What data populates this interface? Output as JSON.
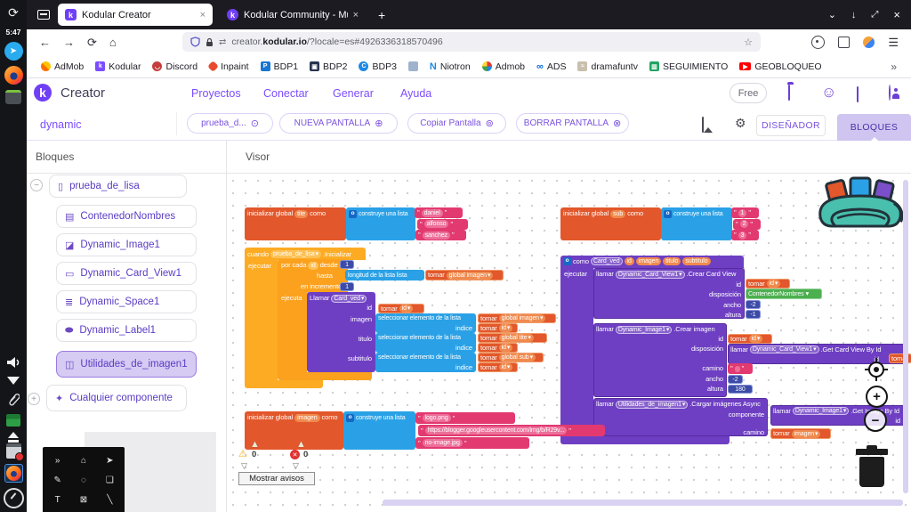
{
  "taskbar": {
    "time": "5:47"
  },
  "browser": {
    "tab1": "Kodular Creator",
    "tab2": "Kodular Community - Mu",
    "url_prefix": "creator.",
    "url_domain": "kodular.io",
    "url_path": "/?locale=es#4926336318570496",
    "bm": [
      "AdMob",
      "Kodular",
      "Discord",
      "Inpaint",
      "BDP1",
      "BDP2",
      "BDP3",
      "Niotron",
      "Admob",
      "ADS",
      "dramafuntv",
      "SEGUIMIENTO",
      "GEOBLOQUEO"
    ]
  },
  "header": {
    "brand": "Creator",
    "m1": "Proyectos",
    "m2": "Conectar",
    "m3": "Generar",
    "m4": "Ayuda",
    "free": "Free"
  },
  "toolbar": {
    "project": "dynamic",
    "screen": "prueba_d...",
    "new_screen": "NUEVA PANTALLA",
    "copy": "Copiar Pantalla",
    "del": "BORRAR PANTALLA",
    "designer": "DISEÑADOR",
    "blocks": "BLOQUES"
  },
  "sidebar": {
    "title": "Bloques",
    "screen": "prueba_de_lisa",
    "i1": "ContenedorNombres",
    "i2": "Dynamic_Image1",
    "i3": "Dynamic_Card_View1",
    "i4": "Dynamic_Space1",
    "i5": "Dynamic_Label1",
    "i6": "Utilidades_de_imagen1",
    "any": "Cualquier componente"
  },
  "visor": {
    "title": "Visor",
    "warn": "0",
    "err": "0",
    "show": "Mostrar avisos"
  },
  "lbl": {
    "init": "inicializar global",
    "como": "como",
    "lista": "construye una lista",
    "tomar": "tomar",
    "indice": "indice",
    "sel": "seleccionar elemento de la lista",
    "llamar": "llamar",
    "Llamar": "Llamar",
    "ejecutar": "ejecutar",
    "ejecuta": "ejecuta",
    "id": "id",
    "imagen": "imagen",
    "titulo": "titulo",
    "subtitulo": "subtitulo",
    "camino": "camino",
    "ancho": "ancho",
    "altura": "altura",
    "disp": "disposición",
    "comp": "componente",
    "q": "\""
  },
  "b_tite": {
    "v": "tite",
    "i1": "daniel",
    "i2": "alfonso",
    "i3": "sanchez"
  },
  "b_sub": {
    "v": "sub",
    "i1": "1",
    "i2": "2",
    "i3": "3"
  },
  "b_img": {
    "v": "imagen",
    "i1": "logo.png",
    "i2": "https://blogger.googleusercontent.com/img/b/R29v...",
    "i3": "no-image.jpg"
  },
  "b_main": {
    "cuando": "cuando",
    "screen": "prueba_de_lisa",
    "ev": ".Inicializar",
    "por": "por cada",
    "desde": "desde",
    "n1": "1",
    "hasta": "hasta",
    "len": "longitud de la lista   lista",
    "gimg": "global imagen",
    "inc": "en incrementos de",
    "n1b": "1",
    "proc": "Card_ved",
    "gtite": "global tite",
    "gsub": "global sub"
  },
  "b_proc": {
    "proc": "Card_ved",
    "p1": "id",
    "p2": "imagen",
    "p3": "titulo",
    "p4": "subtitulo",
    "c1": "Dynamic_Card_View1",
    "c1m": ".Crear Card View",
    "green": "ContenedorNombres",
    "m2": "-2",
    "m1": "-1",
    "c2": "Dynamic_Image1",
    "c2m": ".Crear imagen",
    "gc": ".Get Card View By Id",
    "n180": "180",
    "c3": "Utilidades_de_imagen1",
    "c3m": ".Cargar imágenes Async",
    "gi": ".Get Image By Id"
  },
  "icons": {
    "caret": "▾",
    "collapse": "−",
    "expand": "+",
    "phone": "▯",
    "cont": "▤",
    "img": "◪",
    "card": "▭",
    "space": "≣",
    "labelic": "⬬",
    "imgutil": "◫",
    "spark": "✦",
    "back": "←",
    "fwd": "→",
    "reload": "⟳",
    "home": "⌂",
    "star": "☆",
    "menu": "☰",
    "chevron": "⌄",
    "down": "↓",
    "close": "×",
    "plus": "+",
    "more": "»",
    "swap": "⇄",
    "selopt": "⊙",
    "addc": "⊕",
    "copyc": "⊚",
    "delc": "⊗",
    "gear": "⚙",
    "warn": "⚠",
    "errx": "✕",
    "chevd": "▽",
    "coltri": "▲",
    "zin": "+",
    "zout": "−",
    "mut": "o",
    "p1": "»",
    "p2": "⌂",
    "p3": "➤",
    "p4": "✎",
    "p5": "◌",
    "p6": "❏",
    "p7": "T",
    "p8": "⊠",
    "p9": "╲"
  }
}
